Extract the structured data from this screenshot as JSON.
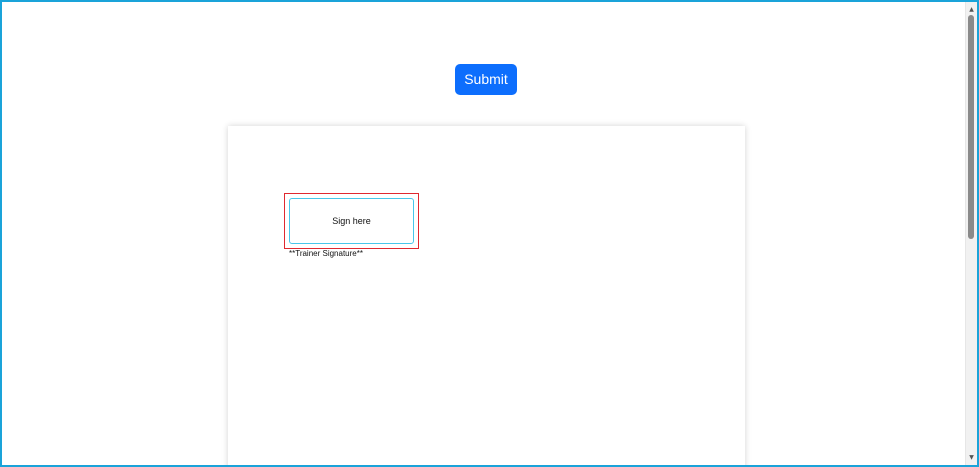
{
  "submit_button": {
    "label": "Submit"
  },
  "document": {
    "signature_box": {
      "placeholder": "Sign here"
    },
    "signature_caption": "**Trainer Signature**"
  },
  "scrollbar": {
    "up_arrow": "▲",
    "down_arrow": "▼"
  },
  "colors": {
    "accent": "#0d6efd",
    "window_border": "#1aa3d9",
    "signature_outline": "#e0282f",
    "signature_field_border": "#49c6ea"
  }
}
